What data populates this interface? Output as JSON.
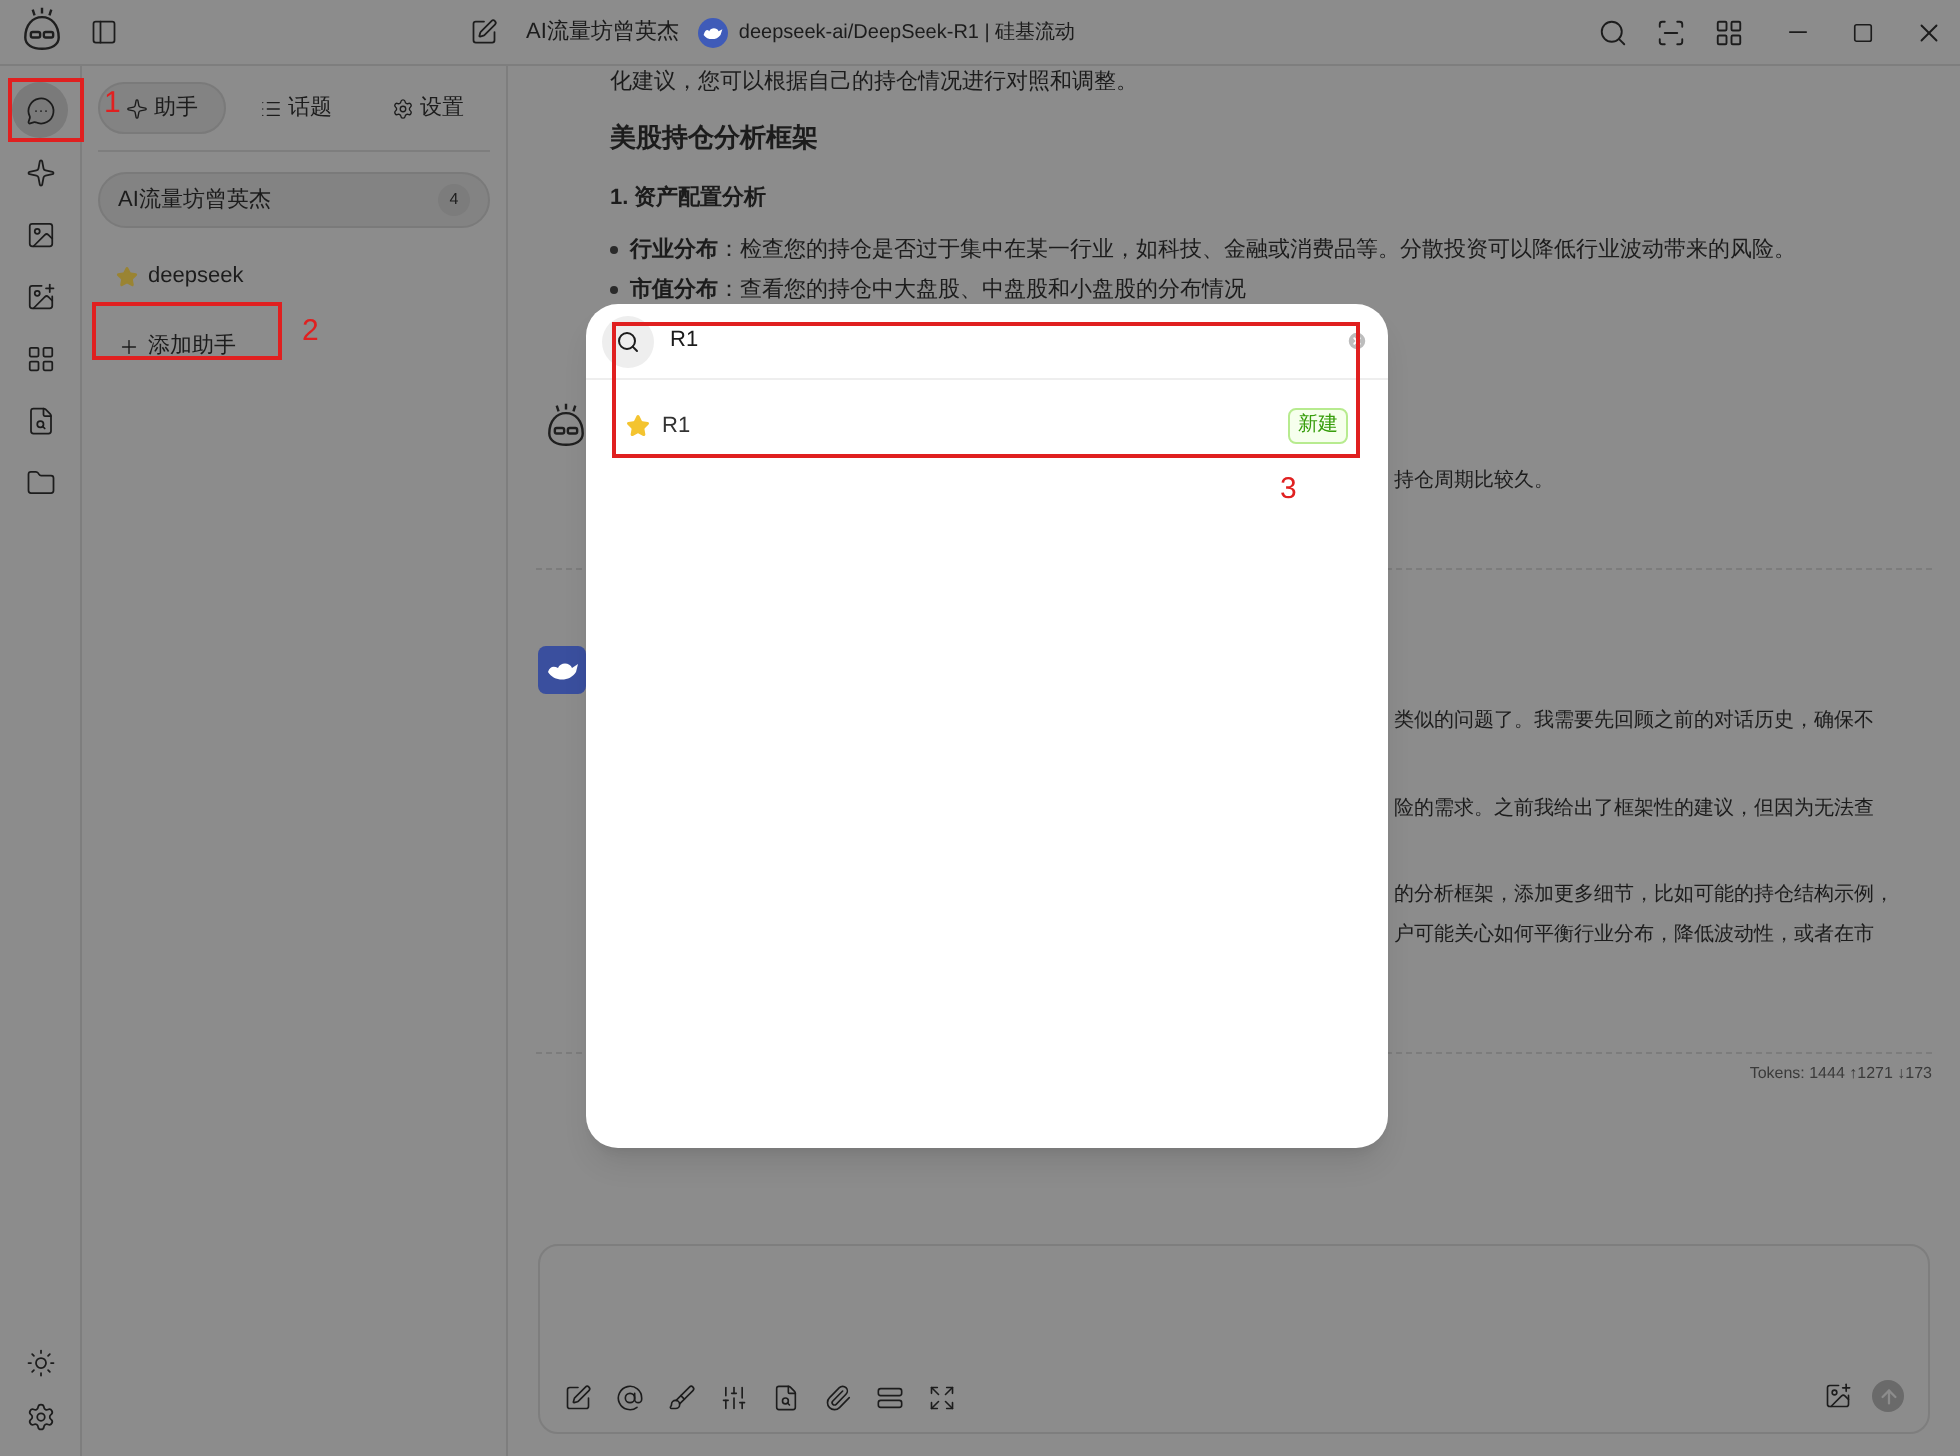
{
  "title_bar": {
    "topic": "AI流量坊曾英杰",
    "model": "deepseek-ai/DeepSeek-R1 | 硅基流动"
  },
  "nav_rail": [
    {
      "selected": true
    },
    {
      "selected": false
    },
    {
      "selected": false
    },
    {
      "selected": false
    },
    {
      "selected": false
    },
    {
      "selected": false
    },
    {
      "selected": false
    }
  ],
  "assistant_panel": {
    "tabs": [
      {
        "label": "助手",
        "selected": true
      },
      {
        "label": "话题",
        "selected": false
      },
      {
        "label": "设置",
        "selected": false
      }
    ],
    "assistants": [
      {
        "name": "AI流量坊曾英杰",
        "count": "4",
        "selected": true
      },
      {
        "name": "deepseek",
        "selected": false
      }
    ],
    "add_button": "添加助手"
  },
  "chat": {
    "intro": "化建议，您可以根据自己的持仓情况进行对照和调整。",
    "heading": "美股持仓分析框架",
    "subheading": "1. 资产配置分析",
    "bullets": [
      "**行业分布**：检查您的持仓是否过于集中在某一行业，如科技、金融或消费品等。分散投资可以降低行业波动带来的风险。",
      "**市值分布**：查看您的持仓中大盘股、中盘股和小盘股的分布情况"
    ],
    "reply_fragment": "持仓周期比较久。",
    "thinking_fragments": [
      "类似的问题了。我需要先回顾之前的对话历史，确保不",
      "险的需求。之前我给出了框架性的建议，但因为无法查",
      "的分析框架，添加更多细节，比如可能的持仓结构示例，",
      "户可能关心如何平衡行业分布，降低波动性，或者在市"
    ],
    "tokens": "Tokens: 1444 ↑1271 ↓173"
  },
  "dialog": {
    "search": {
      "value": "R1"
    },
    "results": [
      {
        "name": "R1",
        "tag": "新建"
      }
    ]
  },
  "annotations": [
    {
      "label": "1"
    },
    {
      "label": "2"
    },
    {
      "label": "3"
    }
  ]
}
